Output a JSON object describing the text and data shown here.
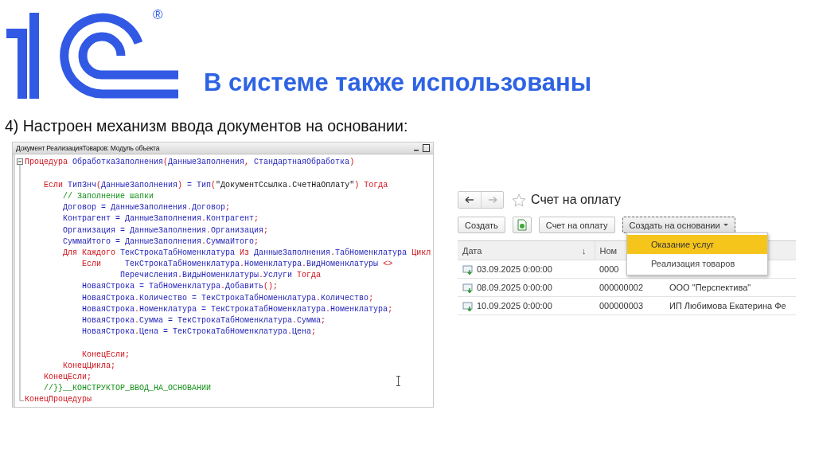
{
  "logo": {
    "mark": "®"
  },
  "title": "В системе также использованы",
  "subtitle": "4) Настроен механизм ввода документов на основании:",
  "code_window": {
    "title": "Документ РеализацияТоваров: Модуль объекта",
    "lines": [
      {
        "segments": [
          {
            "text": "Процедура ",
            "kind": "kw"
          },
          {
            "text": "ОбработкаЗаполнения",
            "kind": "id"
          },
          {
            "text": "(",
            "kind": "p"
          },
          {
            "text": "ДанныеЗаполнения",
            "kind": "id"
          },
          {
            "text": ", ",
            "kind": "p"
          },
          {
            "text": "СтандартнаяОбработка",
            "kind": "id"
          },
          {
            "text": ")",
            "kind": "p"
          }
        ]
      },
      {
        "kind": "blank"
      },
      {
        "segments": [
          {
            "text": "    Если ",
            "kind": "kw"
          },
          {
            "text": "ТипЗнч",
            "kind": "id"
          },
          {
            "text": "(",
            "kind": "p"
          },
          {
            "text": "ДанныеЗаполнения",
            "kind": "id"
          },
          {
            "text": ")",
            "kind": "p"
          },
          {
            "text": " = Тип",
            "kind": "id"
          },
          {
            "text": "(",
            "kind": "p"
          },
          {
            "text": "\"ДокументСсылка.СчетНаОплату\"",
            "kind": "str"
          },
          {
            "text": ")",
            "kind": "p"
          },
          {
            "text": " Тогда",
            "kind": "kw"
          }
        ]
      },
      {
        "segments": [
          {
            "text": "        // Заполнение шапки",
            "kind": "com"
          }
        ]
      },
      {
        "segments": [
          {
            "text": "        Договор = ДанныеЗаполнения",
            "kind": "id"
          },
          {
            "text": ".",
            "kind": "p"
          },
          {
            "text": "Договор",
            "kind": "id"
          },
          {
            "text": ";",
            "kind": "p"
          }
        ]
      },
      {
        "segments": [
          {
            "text": "        Контрагент = ДанныеЗаполнения",
            "kind": "id"
          },
          {
            "text": ".",
            "kind": "p"
          },
          {
            "text": "Контрагент",
            "kind": "id"
          },
          {
            "text": ";",
            "kind": "p"
          }
        ]
      },
      {
        "segments": [
          {
            "text": "        Организация = ДанныеЗаполнения",
            "kind": "id"
          },
          {
            "text": ".",
            "kind": "p"
          },
          {
            "text": "Организация",
            "kind": "id"
          },
          {
            "text": ";",
            "kind": "p"
          }
        ]
      },
      {
        "segments": [
          {
            "text": "        СуммаИтого = ДанныеЗаполнения",
            "kind": "id"
          },
          {
            "text": ".",
            "kind": "p"
          },
          {
            "text": "СуммаИтого",
            "kind": "id"
          },
          {
            "text": ";",
            "kind": "p"
          }
        ]
      },
      {
        "segments": [
          {
            "text": "        Для Каждого ",
            "kind": "kw"
          },
          {
            "text": "ТекСтрокаТабНоменклатура ",
            "kind": "id"
          },
          {
            "text": "Из ",
            "kind": "kw"
          },
          {
            "text": "ДанныеЗаполнения",
            "kind": "id"
          },
          {
            "text": ".",
            "kind": "p"
          },
          {
            "text": "ТабНоменклатура ",
            "kind": "id"
          },
          {
            "text": "Цикл",
            "kind": "kw"
          }
        ]
      },
      {
        "segments": [
          {
            "text": "            Если     ",
            "kind": "kw"
          },
          {
            "text": "ТекСтрокаТабНоменклатура",
            "kind": "id"
          },
          {
            "text": ".",
            "kind": "p"
          },
          {
            "text": "Номенклатура",
            "kind": "id"
          },
          {
            "text": ".",
            "kind": "p"
          },
          {
            "text": "ВидНоменклатуры ",
            "kind": "id"
          },
          {
            "text": "<>",
            "kind": "p"
          }
        ]
      },
      {
        "segments": [
          {
            "text": "                    Перечисления",
            "kind": "id"
          },
          {
            "text": ".",
            "kind": "p"
          },
          {
            "text": "ВидыНоменклатуры",
            "kind": "id"
          },
          {
            "text": ".",
            "kind": "p"
          },
          {
            "text": "Услуги ",
            "kind": "id"
          },
          {
            "text": "Тогда",
            "kind": "kw"
          }
        ]
      },
      {
        "segments": [
          {
            "text": "            НоваяСтрока = ТабНоменклатура",
            "kind": "id"
          },
          {
            "text": ".",
            "kind": "p"
          },
          {
            "text": "Добавить",
            "kind": "id"
          },
          {
            "text": "();",
            "kind": "p"
          }
        ]
      },
      {
        "segments": [
          {
            "text": "            НоваяСтрока",
            "kind": "id"
          },
          {
            "text": ".",
            "kind": "p"
          },
          {
            "text": "Количество = ТекСтрокаТабНоменклатура",
            "kind": "id"
          },
          {
            "text": ".",
            "kind": "p"
          },
          {
            "text": "Количество",
            "kind": "id"
          },
          {
            "text": ";",
            "kind": "p"
          }
        ]
      },
      {
        "segments": [
          {
            "text": "            НоваяСтрока",
            "kind": "id"
          },
          {
            "text": ".",
            "kind": "p"
          },
          {
            "text": "Номенклатура = ТекСтрокаТабНоменклатура",
            "kind": "id"
          },
          {
            "text": ".",
            "kind": "p"
          },
          {
            "text": "Номенклатура",
            "kind": "id"
          },
          {
            "text": ";",
            "kind": "p"
          }
        ]
      },
      {
        "segments": [
          {
            "text": "            НоваяСтрока",
            "kind": "id"
          },
          {
            "text": ".",
            "kind": "p"
          },
          {
            "text": "Сумма = ТекСтрокаТабНоменклатура",
            "kind": "id"
          },
          {
            "text": ".",
            "kind": "p"
          },
          {
            "text": "Сумма",
            "kind": "id"
          },
          {
            "text": ";",
            "kind": "p"
          }
        ]
      },
      {
        "segments": [
          {
            "text": "            НоваяСтрока",
            "kind": "id"
          },
          {
            "text": ".",
            "kind": "p"
          },
          {
            "text": "Цена = ТекСтрокаТабНоменклатура",
            "kind": "id"
          },
          {
            "text": ".",
            "kind": "p"
          },
          {
            "text": "Цена",
            "kind": "id"
          },
          {
            "text": ";",
            "kind": "p"
          }
        ]
      },
      {
        "kind": "blank"
      },
      {
        "segments": [
          {
            "text": "            КонецЕсли;",
            "kind": "kw"
          }
        ]
      },
      {
        "segments": [
          {
            "text": "        КонецЦикла;",
            "kind": "kw"
          }
        ]
      },
      {
        "segments": [
          {
            "text": "    КонецЕсли;",
            "kind": "kw"
          }
        ]
      },
      {
        "segments": [
          {
            "text": "    //}}__КОНСТРУКТОР_ВВОД_НА_ОСНОВАНИИ",
            "kind": "com"
          }
        ]
      },
      {
        "segments": [
          {
            "text": "КонецПроцедуры",
            "kind": "kw"
          }
        ]
      }
    ]
  },
  "list_form": {
    "title": "Счет на оплату",
    "navigation": [
      {
        "kind": "back",
        "disabled": false
      },
      {
        "kind": "forward",
        "disabled": true
      }
    ],
    "toolbar": [
      {
        "kind": "text",
        "label": "Создать"
      },
      {
        "kind": "icon"
      },
      {
        "kind": "text",
        "label": "Счет на оплату"
      },
      {
        "kind": "menu",
        "label": "Создать на основании"
      }
    ],
    "menu": [
      {
        "label": "Оказание услуг",
        "selected": true
      },
      {
        "label": "Реализация товаров",
        "selected": false
      }
    ],
    "columns": [
      {
        "label": "Дата",
        "sort": "↓"
      },
      {
        "label": "Ном"
      }
    ],
    "rows": [
      {
        "date": "03.09.2025 0:00:00",
        "number": "0000"
      },
      {
        "date": "08.09.2025 0:00:00",
        "number": "000000002",
        "counterparty": "ООО \"Перспектива\""
      },
      {
        "date": "10.09.2025 0:00:00",
        "number": "000000003",
        "counterparty": "ИП Любимова Екатерина Фе"
      }
    ]
  }
}
